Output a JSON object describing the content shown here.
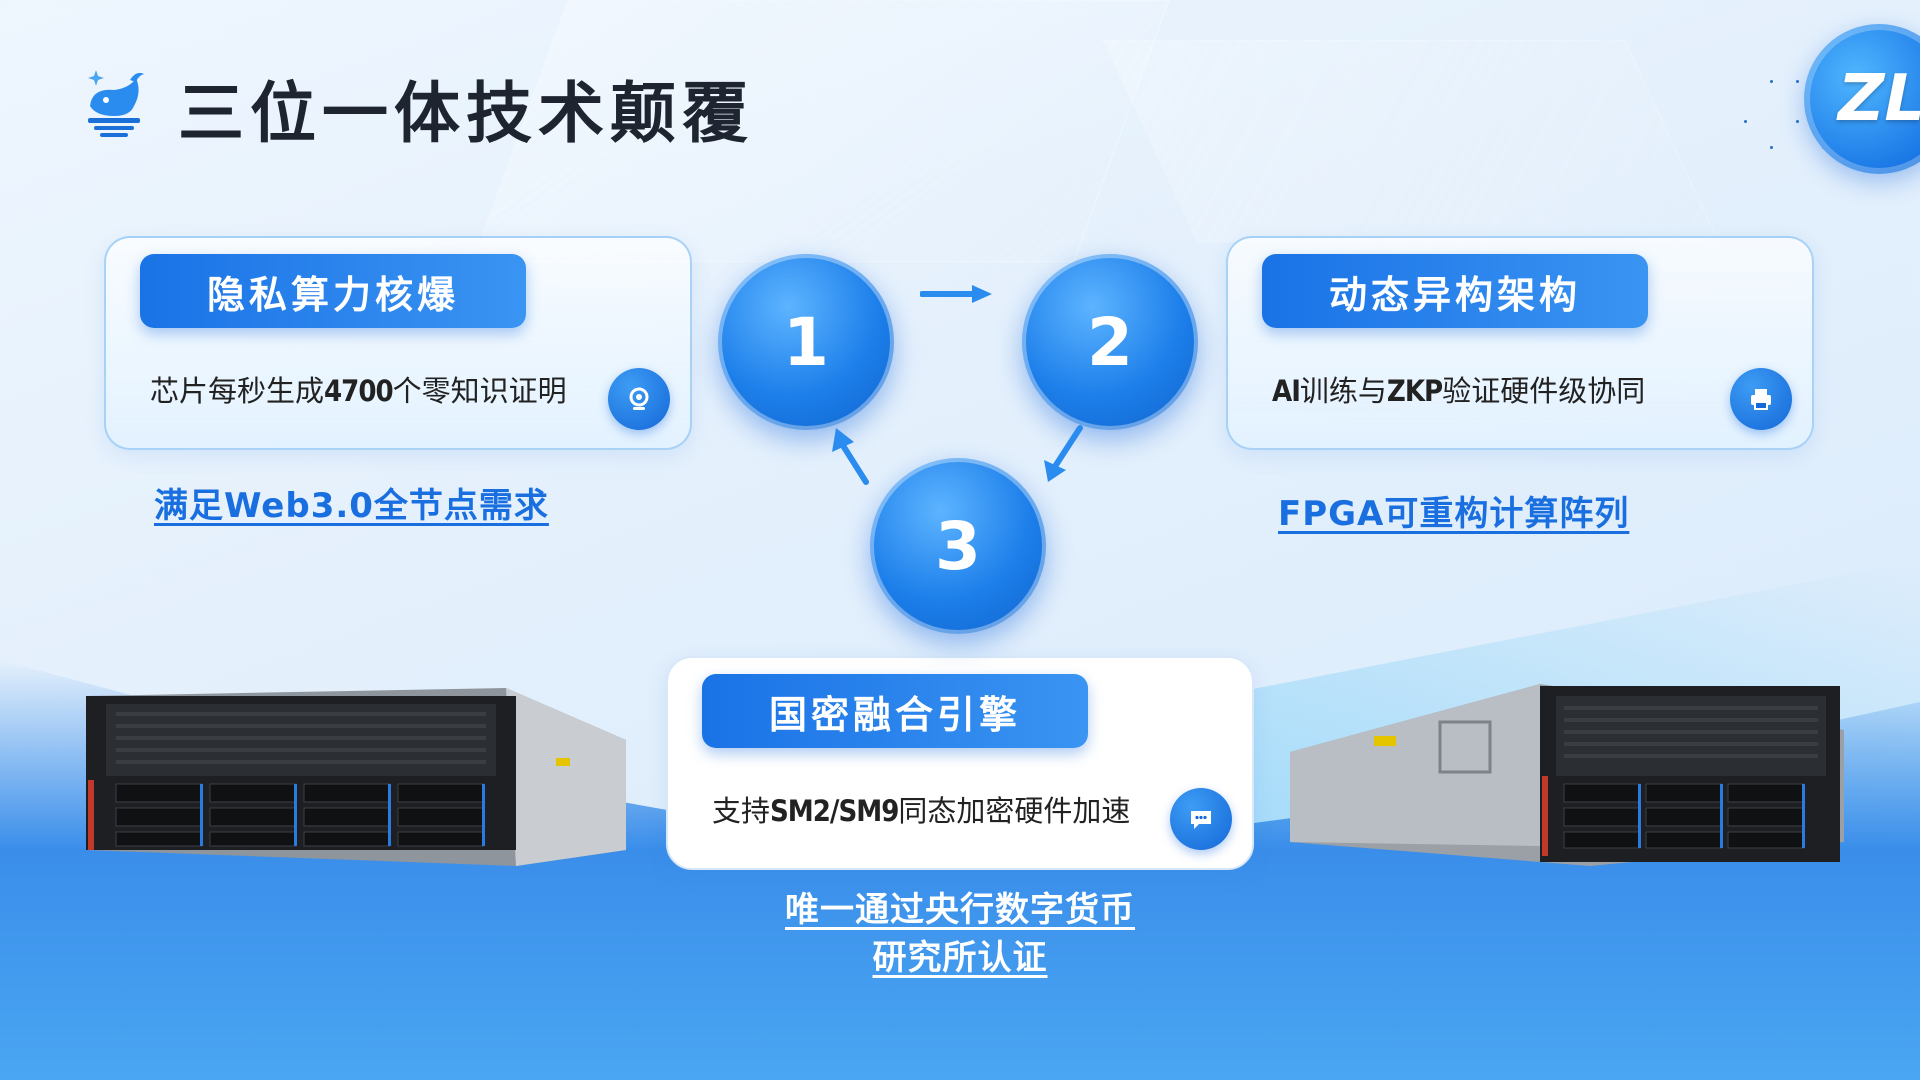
{
  "header": {
    "title": "三位一体技术颠覆",
    "badge_letters": "ZL"
  },
  "cards": [
    {
      "label": "隐私算力核爆",
      "text_pre": "芯片每秒生成",
      "text_strong": "4700",
      "text_post": "个零知识证明",
      "icon": "webcam-icon",
      "note": "满足Web3.0全节点需求"
    },
    {
      "label": "动态异构架构",
      "text_strong1": "AI",
      "text_mid": "训练与",
      "text_strong2": "ZKP",
      "text_post": "验证硬件级协同",
      "icon": "printer-icon",
      "note": "FPGA可重构计算阵列"
    },
    {
      "label": "国密融合引擎",
      "text_pre": "支持",
      "text_strong": "SM2/SM9",
      "text_post": "同态加密硬件加速",
      "icon": "chat-icon",
      "note_line1": "唯一通过央行数字货币",
      "note_line2": "研究所认证"
    }
  ],
  "steps": [
    "1",
    "2",
    "3"
  ],
  "colors": {
    "accent": "#1a73e6",
    "accent_light": "#3a94f2",
    "title": "#1e2430"
  }
}
